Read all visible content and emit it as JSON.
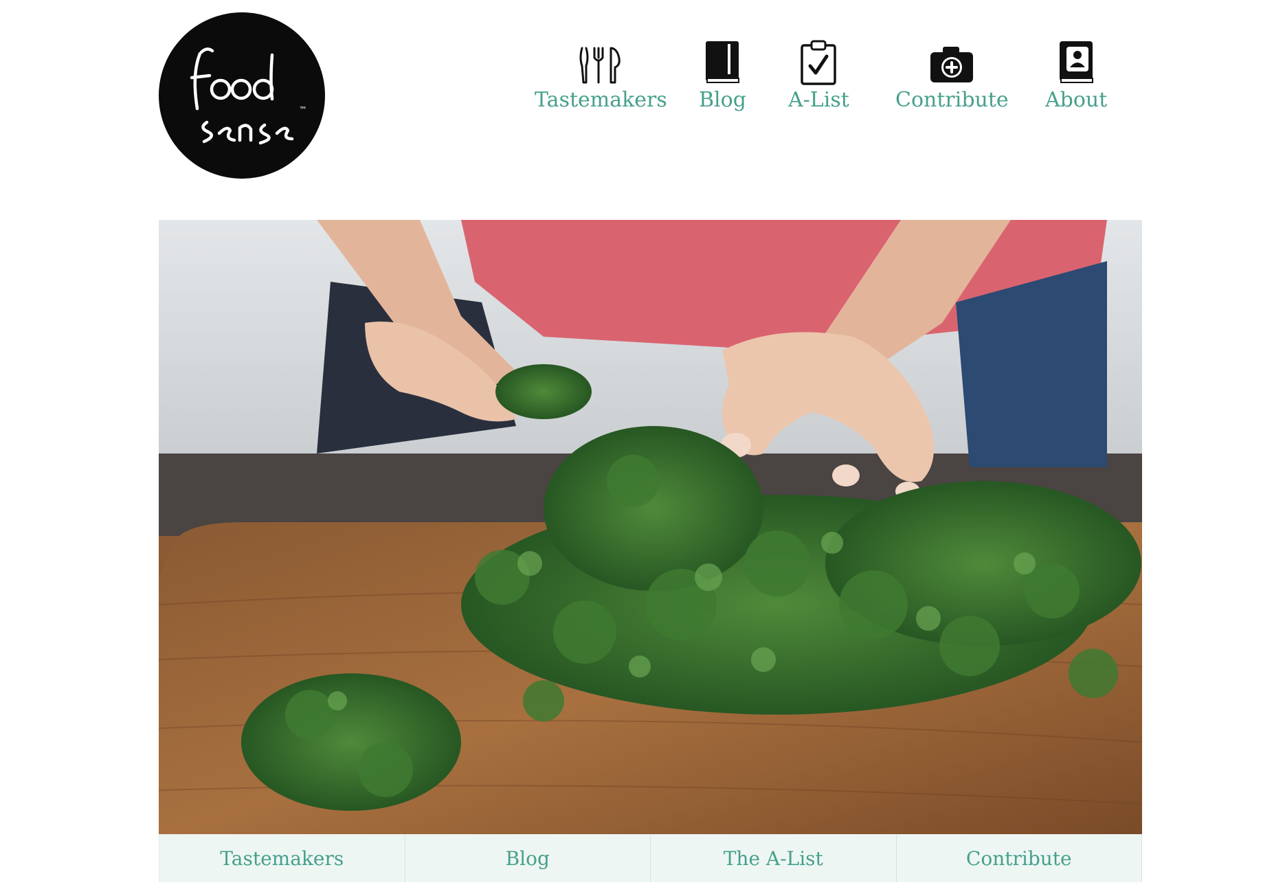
{
  "brand": {
    "logo_text_line1": "food",
    "logo_text_line2": "sense",
    "trademark": "™"
  },
  "nav": {
    "items": [
      {
        "label": "Tastemakers",
        "icon": "utensils-icon"
      },
      {
        "label": "Blog",
        "icon": "book-icon"
      },
      {
        "label": "A-List",
        "icon": "clipboard-check-icon"
      },
      {
        "label": "Contribute",
        "icon": "camera-plus-icon"
      },
      {
        "label": "About",
        "icon": "contact-book-icon"
      }
    ]
  },
  "hero": {
    "subject": "hands picking fresh parsley leaves on a wooden cutting board"
  },
  "subnav": {
    "items": [
      {
        "label": "Tastemakers"
      },
      {
        "label": "Blog"
      },
      {
        "label": "The A-List"
      },
      {
        "label": "Contribute"
      }
    ]
  },
  "colors": {
    "accent": "#45a08b",
    "subnav_bg": "#eef6f4",
    "logo_bg": "#0b0b0b"
  }
}
